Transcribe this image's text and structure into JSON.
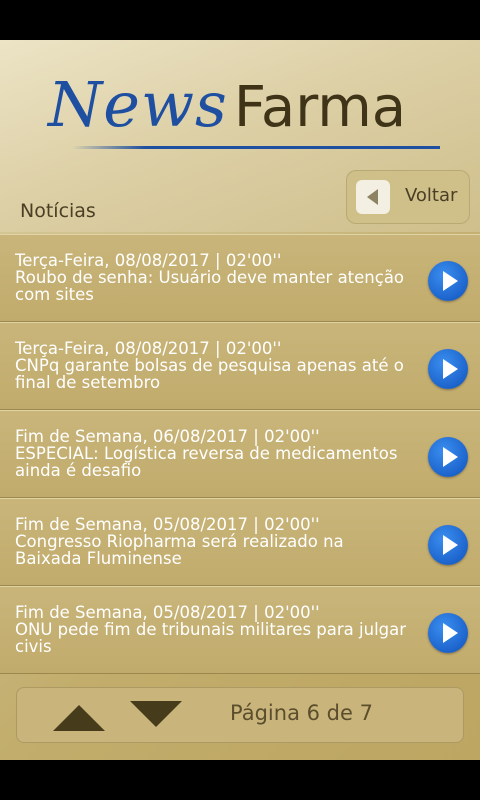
{
  "header": {
    "logo_news": "News",
    "logo_farma": "Farma",
    "section_title": "Notícias",
    "back_label": "Voltar"
  },
  "news": [
    {
      "date": "Terça-Feira, 08/08/2017 | 02'00''",
      "title": "Roubo de senha: Usuário deve manter atenção com sites"
    },
    {
      "date": "Terça-Feira, 08/08/2017 | 02'00''",
      "title": "CNPq garante bolsas de pesquisa apenas até o final de setembro"
    },
    {
      "date": "Fim de Semana, 06/08/2017 | 02'00''",
      "title": "ESPECIAL: Logística reversa de medicamentos ainda é desafio"
    },
    {
      "date": "Fim de Semana, 05/08/2017 | 02'00''",
      "title": "Congresso Riopharma será realizado na Baixada Fluminense"
    },
    {
      "date": "Fim de Semana, 05/08/2017 | 02'00''",
      "title": "ONU pede fim de tribunais militares para julgar civis"
    }
  ],
  "pager": {
    "label": "Página 6 de 7"
  },
  "icons": {
    "back": "left-triangle-icon",
    "open_item": "play-icon",
    "prev_page": "up-arrow-icon",
    "next_page": "down-arrow-icon"
  },
  "colors": {
    "logo_blue": "#1e4fa0",
    "logo_brown": "#3f3318",
    "item_background": "#c5b074",
    "play_button": "#1c64cc"
  }
}
